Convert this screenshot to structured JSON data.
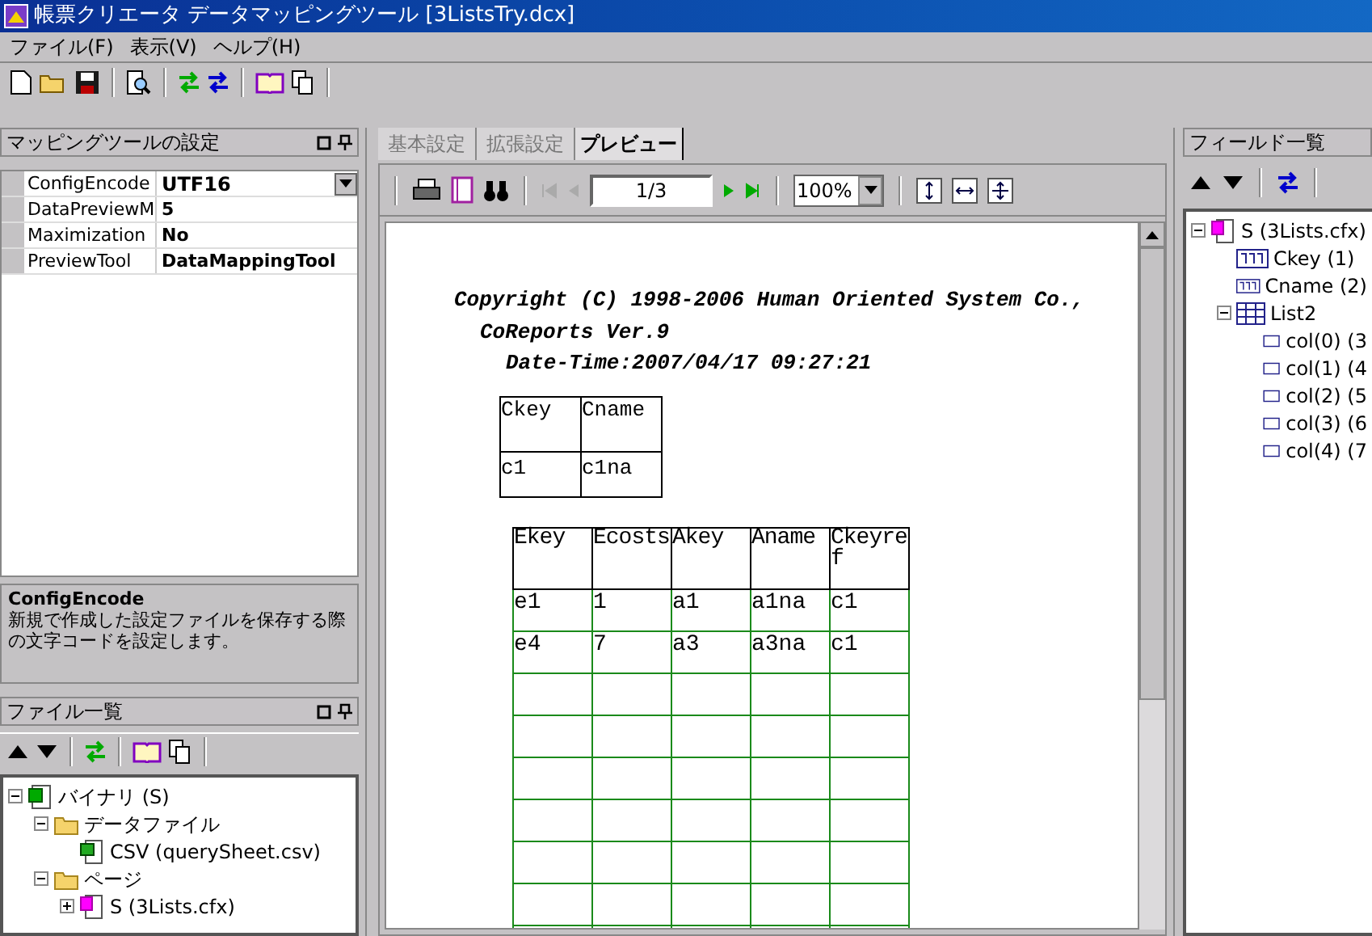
{
  "window": {
    "title": "帳票クリエータ データマッピングツール [3ListsTry.dcx]"
  },
  "menu": [
    "ファイル(F)",
    "表示(V)",
    "ヘルプ(H)"
  ],
  "settings_panel": {
    "title": "マッピングツールの設定",
    "properties": [
      {
        "name": "ConfigEncode",
        "value": "UTF16",
        "kind": "dropdown"
      },
      {
        "name": "DataPreviewM",
        "value": "5",
        "kind": "text"
      },
      {
        "name": "Maximization",
        "value": "No",
        "kind": "text"
      },
      {
        "name": "PreviewTool",
        "value": "DataMappingTool",
        "kind": "text"
      }
    ],
    "description": {
      "title": "ConfigEncode",
      "text": "新規で作成した設定ファイルを保存する際の文字コードを設定します。"
    }
  },
  "file_panel": {
    "title": "ファイル一覧",
    "tree": [
      {
        "label": "バイナリ (S)",
        "kind": "binary",
        "expanded": true,
        "children": [
          {
            "label": "データファイル",
            "kind": "folder",
            "expanded": true,
            "children": [
              {
                "label": "CSV (querySheet.csv)",
                "kind": "csv"
              }
            ]
          },
          {
            "label": "ページ",
            "kind": "folder",
            "expanded": true,
            "children": [
              {
                "label": "S (3Lists.cfx)",
                "kind": "page",
                "expanded": false
              }
            ]
          }
        ]
      }
    ]
  },
  "tabs": [
    {
      "label": "基本設定",
      "selected": false
    },
    {
      "label": "拡張設定",
      "selected": false
    },
    {
      "label": "プレビュー",
      "selected": true
    }
  ],
  "preview": {
    "page_field": "1/3",
    "zoom": "100%",
    "lines": [
      "Copyright (C) 1998-2006 Human Oriented System Co.,",
      "CoReports Ver.9",
      "Date-Time:2007/04/17 09:27:21"
    ],
    "table1": {
      "columns": [
        "Ckey",
        "Cname"
      ],
      "rows": [
        [
          "c1",
          "c1na"
        ]
      ]
    },
    "table2": {
      "columns": [
        "Ekey",
        "Ecosts",
        "Akey",
        "Aname",
        "Ckeyref"
      ],
      "rows": [
        [
          "e1",
          "1",
          "a1",
          "a1na",
          "c1"
        ],
        [
          "e4",
          "7",
          "a3",
          "a3na",
          "c1"
        ]
      ]
    }
  },
  "field_panel": {
    "title": "フィールド一覧",
    "tree": [
      {
        "label": "S (3Lists.cfx)",
        "kind": "page",
        "expanded": true,
        "children": [
          {
            "label": "Ckey (1)",
            "kind": "field"
          },
          {
            "label": "Cname (2)",
            "kind": "field"
          },
          {
            "label": "List2",
            "kind": "list",
            "expanded": true,
            "children": [
              {
                "label": "col(0) (3",
                "kind": "column"
              },
              {
                "label": "col(1) (4",
                "kind": "column"
              },
              {
                "label": "col(2) (5",
                "kind": "column"
              },
              {
                "label": "col(3) (6",
                "kind": "column"
              },
              {
                "label": "col(4) (7",
                "kind": "column"
              }
            ]
          }
        ]
      }
    ]
  }
}
